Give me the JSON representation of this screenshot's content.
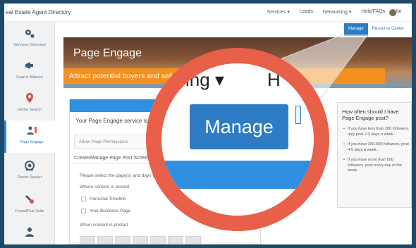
{
  "brand": "eal Estate Agent Directory",
  "nav": [
    "Services ▾",
    "Leads",
    "Networking ▾",
    "Help/FAQs",
    "Jar"
  ],
  "sidebar": [
    {
      "label": "Services Overview",
      "icon": "gears-icon"
    },
    {
      "label": "Search Alliance",
      "icon": "megaphone-icon"
    },
    {
      "label": "Home Search",
      "icon": "location-pin-icon"
    },
    {
      "label": "Page Engage",
      "icon": "users-icon",
      "active": true
    },
    {
      "label": "Desire Seeker",
      "icon": "eye-icon"
    },
    {
      "label": "FunnelFlux Suite",
      "icon": "satellite-icon"
    },
    {
      "label": "",
      "icon": "person-icon"
    }
  ],
  "subtabs": {
    "manage": "Manage",
    "resource": "Resource Center"
  },
  "hero": {
    "title": "Page Engage",
    "subtitle": "Attract potential buyers and sell"
  },
  "card": {
    "notice": "Your Page Engage service is almos",
    "permissions": "Allow Page Permissions",
    "schedule_title": "Create/Manage Page Post Schedule",
    "instruction": "Please select the page(s) and days you w",
    "where_label": "Where content is posted",
    "options": [
      "Personal Timeline",
      "Your Business Page"
    ],
    "when_label": "When content is posted"
  },
  "tips": {
    "title": "How often should I have Page Engage post?",
    "items": [
      "If you have less than 200 followers, only post 2-3 days a week.",
      "If you have 200-500 followers, post 4-5 days a week.",
      "If you have more than 500 followers, post every day of the week."
    ]
  },
  "magnifier": {
    "dropdown_text": "ing ▾",
    "partial_text": "H",
    "button_label": "Manage"
  },
  "colors": {
    "ring": "#e8604a",
    "button": "#2e7cc4",
    "orange_band": "#f28f1f",
    "frame": "#1d4a68"
  }
}
